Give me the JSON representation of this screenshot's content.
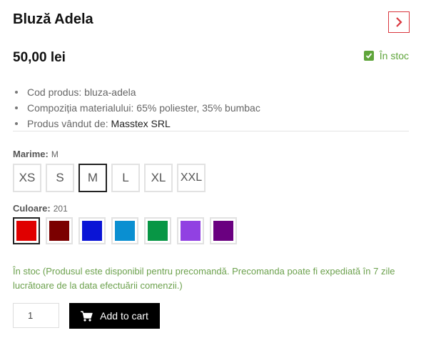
{
  "product": {
    "title": "Bluză Adela",
    "price": "50,00 lei",
    "stock_status": "În stoc",
    "specs": [
      {
        "text": "Cod produs: bluza-adela"
      },
      {
        "text": "Compoziția materialului: 65% poliester, 35% bumbac"
      },
      {
        "label": "Produs vândut de:",
        "value": "Masstex SRL"
      }
    ]
  },
  "size_option": {
    "label": "Marime:",
    "selected": "M",
    "options": [
      "XS",
      "S",
      "M",
      "L",
      "XL",
      "XXL"
    ]
  },
  "color_option": {
    "label": "Culoare:",
    "selected": "201",
    "swatches": [
      "#e00000",
      "#7b0000",
      "#0a14d6",
      "#0a8fd1",
      "#089645",
      "#9141e2",
      "#6a0080"
    ]
  },
  "availability_note": "În stoc (Produsul este disponibil pentru precomandă. Precomanda poate fi expediată în 7 zile lucrătoare de la data efectuării comenzii.)",
  "cart": {
    "quantity": "1",
    "add_label": "Add to cart"
  },
  "colors": {
    "accent_red": "#d9363e",
    "stock_green": "#5fa53b",
    "note_green": "#6ca14d",
    "button_black": "#000000"
  },
  "icons": {
    "next": "chevron-right-icon",
    "stock": "checkbox-checked-icon",
    "cart": "shopping-cart-icon"
  }
}
